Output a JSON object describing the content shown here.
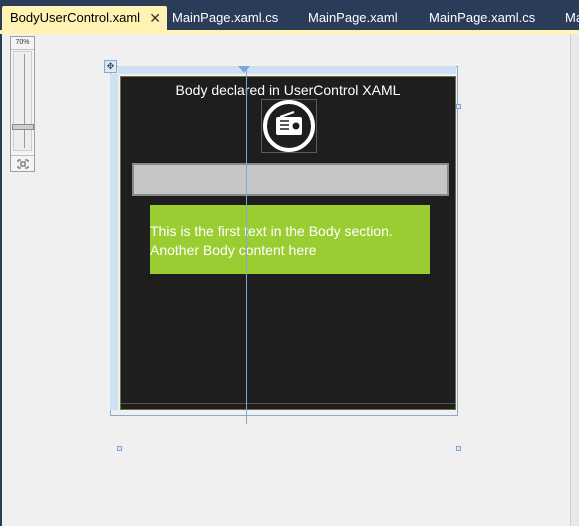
{
  "tabs": [
    {
      "label": "BodyUserControl.xaml",
      "active": true,
      "close_glyph": "✕"
    },
    {
      "label": "MainPage.xaml.cs",
      "active": false
    },
    {
      "label": "MainPage.xaml",
      "active": false
    },
    {
      "label": "MainPage.xaml.cs",
      "active": false
    },
    {
      "label": "Ma",
      "active": false
    }
  ],
  "zoom": {
    "percent_label": "70%",
    "fit_icon": "fit-to-screen-icon"
  },
  "designer": {
    "body_title": "Body declared in UserControl XAML",
    "radio_icon": "radio-icon",
    "textbox_value": "",
    "green_panel": {
      "line1": "This is the first text in the Body section.",
      "line2": "Another Body content here"
    }
  },
  "colors": {
    "tab_strip": "#2b3c59",
    "active_tab": "#fff2b3",
    "designer_bg": "#f0f0f0",
    "control_bg": "#1e1e1e",
    "green_panel": "#9acd32",
    "textbox": "#c6c6c6",
    "selection": "#7fa6d4"
  }
}
